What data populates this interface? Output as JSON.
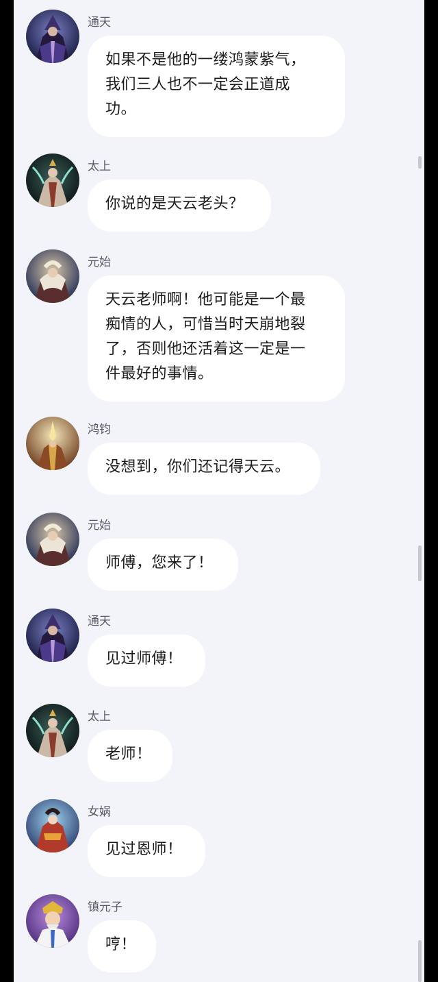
{
  "colors": {
    "background": "#f3f4f9",
    "bubble": "#ffffff",
    "text": "#1c1c1e",
    "sender": "#555a66",
    "frame": "#000000"
  },
  "messages": [
    {
      "sender": "通天",
      "avatar": "tongtian-avatar",
      "lines": [
        "如果不是他的一缕鸿蒙紫气，",
        "我们三人也不一定会正道成",
        "功。"
      ]
    },
    {
      "sender": "太上",
      "avatar": "taishang-avatar",
      "lines": [
        "你说的是天云老头？"
      ]
    },
    {
      "sender": "元始",
      "avatar": "yuanshi-avatar",
      "lines": [
        "天云老师啊！他可能是一个最",
        "痴情的人，可惜当时天崩地裂",
        "了，否则他还活着这一定是一",
        "件最好的事情。"
      ]
    },
    {
      "sender": "鸿钧",
      "avatar": "hongjun-avatar",
      "lines": [
        "没想到，你们还记得天云。"
      ]
    },
    {
      "sender": "元始",
      "avatar": "yuanshi-avatar",
      "lines": [
        "师傅，您来了！"
      ]
    },
    {
      "sender": "通天",
      "avatar": "tongtian-avatar",
      "lines": [
        "见过师傅！"
      ]
    },
    {
      "sender": "太上",
      "avatar": "taishang-avatar",
      "lines": [
        "老师！"
      ]
    },
    {
      "sender": "女娲",
      "avatar": "nuwa-avatar",
      "lines": [
        "见过恩师！"
      ]
    },
    {
      "sender": "镇元子",
      "avatar": "zhenyuanzi-avatar",
      "lines": [
        "哼！"
      ]
    }
  ]
}
